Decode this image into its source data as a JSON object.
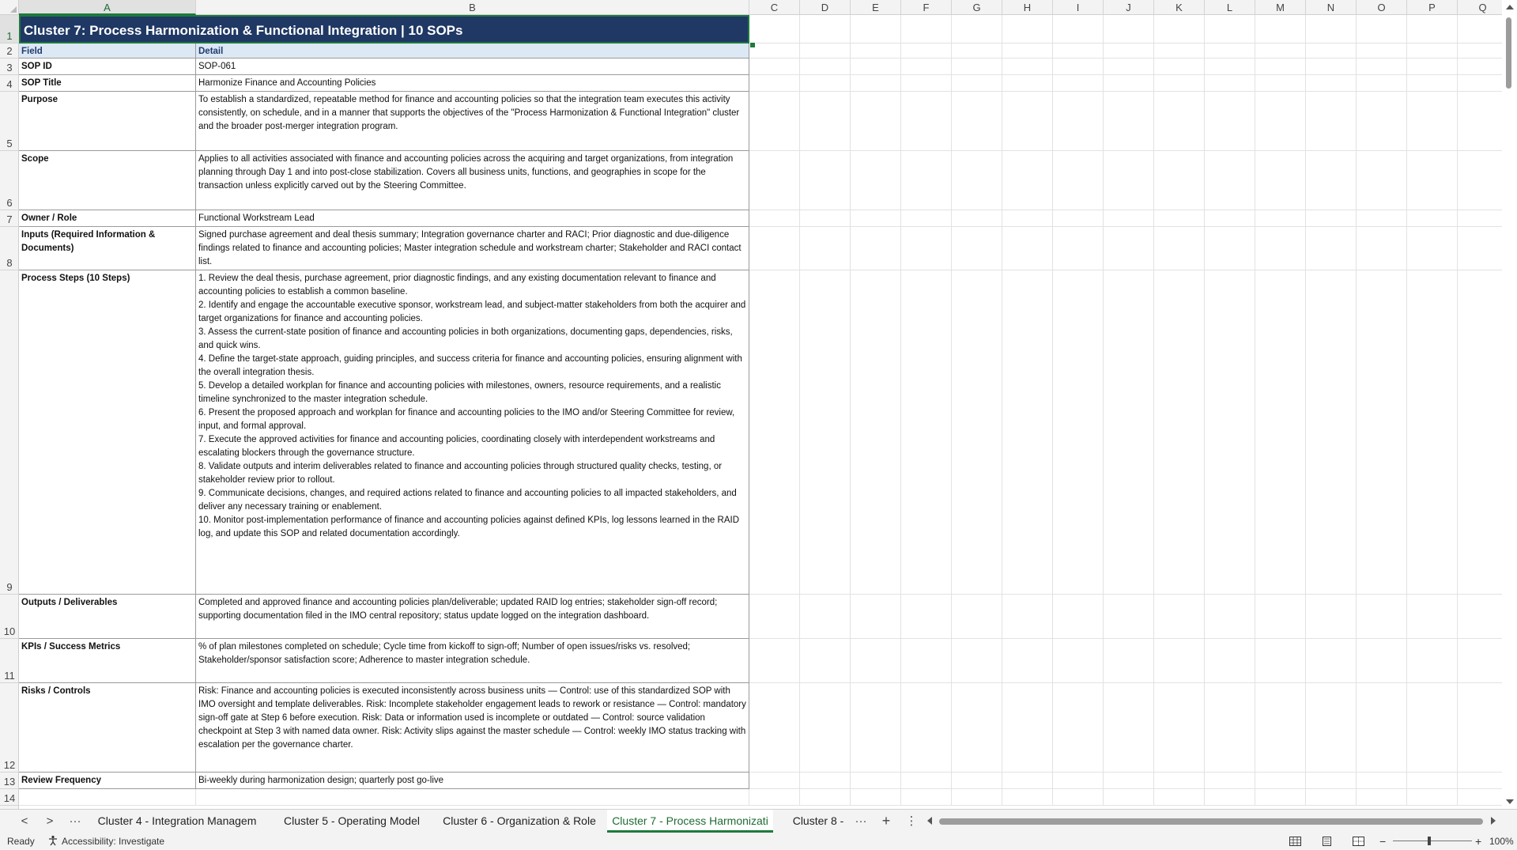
{
  "columns": [
    "A",
    "B",
    "C",
    "D",
    "E",
    "F",
    "G",
    "H",
    "I",
    "J",
    "K",
    "L",
    "M",
    "N",
    "O",
    "P",
    "Q"
  ],
  "rows": [
    "1",
    "2",
    "3",
    "4",
    "5",
    "6",
    "7",
    "8",
    "9",
    "10",
    "11",
    "12",
    "13",
    "14"
  ],
  "banner_title": "Cluster 7: Process Harmonization & Functional Integration  |  10 SOPs",
  "table": {
    "header": {
      "field": "Field",
      "detail": "Detail"
    },
    "rows": [
      {
        "field": "SOP ID",
        "detail": "SOP-061"
      },
      {
        "field": "SOP Title",
        "detail": "Harmonize Finance and Accounting Policies"
      },
      {
        "field": "Purpose",
        "detail": "To establish a standardized, repeatable method for finance and accounting policies so that the integration team executes this activity consistently, on schedule, and in a manner that supports the objectives of the \"Process Harmonization & Functional Integration\" cluster and the broader post-merger integration program."
      },
      {
        "field": "Scope",
        "detail": "Applies to all activities associated with finance and accounting policies across the acquiring and target organizations, from integration planning through Day 1 and into post-close stabilization. Covers all business units, functions, and geographies in scope for the transaction unless explicitly carved out by the Steering Committee."
      },
      {
        "field": "Owner / Role",
        "detail": "Functional Workstream Lead"
      },
      {
        "field": "Inputs (Required Information & Documents)",
        "detail": "Signed purchase agreement and deal thesis summary; Integration governance charter and RACI; Prior diagnostic and due-diligence findings related to finance and accounting policies; Master integration schedule and workstream charter; Stakeholder and RACI contact list."
      },
      {
        "field": "Process Steps (10 Steps)",
        "detail": "1. Review the deal thesis, purchase agreement, prior diagnostic findings, and any existing documentation relevant to finance and accounting policies to establish a common baseline.\n2. Identify and engage the accountable executive sponsor, workstream lead, and subject-matter stakeholders from both the acquirer and target organizations for finance and accounting policies.\n3. Assess the current-state position of finance and accounting policies in both organizations, documenting gaps, dependencies, risks, and quick wins.\n4. Define the target-state approach, guiding principles, and success criteria for finance and accounting policies, ensuring alignment with the overall integration thesis.\n5. Develop a detailed workplan for finance and accounting policies with milestones, owners, resource requirements, and a realistic timeline synchronized to the master integration schedule.\n6. Present the proposed approach and workplan for finance and accounting policies to the IMO and/or Steering Committee for review, input, and formal approval.\n7. Execute the approved activities for finance and accounting policies, coordinating closely with interdependent workstreams and escalating blockers through the governance structure.\n8. Validate outputs and interim deliverables related to finance and accounting policies through structured quality checks, testing, or stakeholder review prior to rollout.\n9. Communicate decisions, changes, and required actions related to finance and accounting policies to all impacted stakeholders, and deliver any necessary training or enablement.\n10. Monitor post-implementation performance of finance and accounting policies against defined KPIs, log lessons learned in the RAID log, and update this SOP and related documentation accordingly."
      },
      {
        "field": "Outputs / Deliverables",
        "detail": "Completed and approved finance and accounting policies plan/deliverable; updated RAID log entries; stakeholder sign-off record; supporting documentation filed in the IMO central repository; status update logged on the integration dashboard."
      },
      {
        "field": "KPIs / Success Metrics",
        "detail": "% of plan milestones completed on schedule; Cycle time from kickoff to sign-off; Number of open issues/risks vs. resolved; Stakeholder/sponsor satisfaction score; Adherence to master integration schedule."
      },
      {
        "field": "Risks / Controls",
        "detail": "Risk: Finance and accounting policies is executed inconsistently across business units — Control: use of this standardized SOP with IMO oversight and template deliverables. Risk: Incomplete stakeholder engagement leads to rework or resistance — Control: mandatory sign-off gate at Step 6 before execution. Risk: Data or information used is incomplete or outdated — Control: source validation checkpoint at Step 3 with named data owner. Risk: Activity slips against the master schedule — Control: weekly IMO status tracking with escalation per the governance charter."
      },
      {
        "field": "Review Frequency",
        "detail": "Bi-weekly during harmonization design; quarterly post go-live"
      }
    ]
  },
  "sheet_tabs": [
    {
      "label": "Cluster 4 - Integration Managem"
    },
    {
      "label": "Cluster 5 - Operating Model"
    },
    {
      "label": "Cluster 6 - Organization & Role"
    },
    {
      "label": "Cluster 7 - Process Harmonizati"
    },
    {
      "label": "Cluster 8 -"
    }
  ],
  "tab_nav": {
    "prev": "<",
    "next": ">",
    "more": "···",
    "add": "+",
    "options": "⋮"
  },
  "status": {
    "ready": "Ready",
    "accessibility": "Accessibility: Investigate",
    "zoom": "100%",
    "zoom_minus": "−",
    "zoom_plus": "+"
  }
}
